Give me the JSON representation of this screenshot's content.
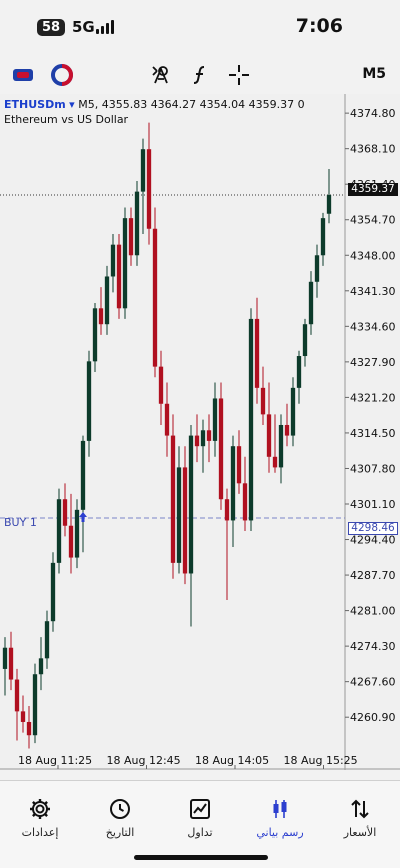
{
  "status_bar": {
    "badge": "58",
    "network": "5G",
    "time": "7:06"
  },
  "toolbar": {
    "icons": [
      "logo-red-blue-icon",
      "logo-blue-circle-icon",
      "indicator-icon",
      "function-icon",
      "crosshair-icon"
    ],
    "timeframe": "M5"
  },
  "chart": {
    "symbol": "ETHUSDm",
    "timeframe": "M5",
    "ohlc": "4355.83 4364.27 4354.04 4359.37 0",
    "subtitle": "Ethereum vs US Dollar",
    "current_price": "4359.37",
    "buy_label": "BUY 1",
    "buy_price": "4298.46",
    "x_labels": [
      "18 Aug 11:25",
      "18 Aug 12:45",
      "18 Aug 14:05",
      "18 Aug 15:25"
    ]
  },
  "chart_data": {
    "type": "candlestick",
    "price_ticks": [
      "4374.80",
      "4368.10",
      "4361.40",
      "4354.70",
      "4348.00",
      "4341.30",
      "4334.60",
      "4327.90",
      "4321.20",
      "4314.50",
      "4307.80",
      "4301.10",
      "4294.40",
      "4287.70",
      "4281.00",
      "4274.30",
      "4267.60",
      "4260.90"
    ],
    "ylim": [
      4256.6,
      4376.9
    ],
    "color_up": "#0d3b2b",
    "color_down": "#b01020",
    "candles": [
      {
        "o": 4270.0,
        "h": 4276.0,
        "l": 4265.0,
        "c": 4274.0
      },
      {
        "o": 4274.0,
        "h": 4277.0,
        "l": 4266.0,
        "c": 4268.0
      },
      {
        "o": 4268.0,
        "h": 4270.0,
        "l": 4256.5,
        "c": 4262.0
      },
      {
        "o": 4262.0,
        "h": 4265.0,
        "l": 4258.0,
        "c": 4260.0
      },
      {
        "o": 4260.0,
        "h": 4263.0,
        "l": 4255.0,
        "c": 4257.5
      },
      {
        "o": 4257.5,
        "h": 4271.0,
        "l": 4256.0,
        "c": 4269.0
      },
      {
        "o": 4269.0,
        "h": 4276.0,
        "l": 4266.0,
        "c": 4272.0
      },
      {
        "o": 4272.0,
        "h": 4281.0,
        "l": 4270.0,
        "c": 4279.0
      },
      {
        "o": 4279.0,
        "h": 4292.0,
        "l": 4277.0,
        "c": 4290.0
      },
      {
        "o": 4290.0,
        "h": 4304.0,
        "l": 4288.0,
        "c": 4302.0
      },
      {
        "o": 4302.0,
        "h": 4305.0,
        "l": 4295.0,
        "c": 4297.0
      },
      {
        "o": 4297.0,
        "h": 4303.0,
        "l": 4288.0,
        "c": 4291.0
      },
      {
        "o": 4291.0,
        "h": 4302.0,
        "l": 4289.0,
        "c": 4300.0
      },
      {
        "o": 4300.0,
        "h": 4314.0,
        "l": 4292.0,
        "c": 4313.0
      },
      {
        "o": 4313.0,
        "h": 4330.0,
        "l": 4310.0,
        "c": 4328.0
      },
      {
        "o": 4328.0,
        "h": 4339.0,
        "l": 4326.0,
        "c": 4338.0
      },
      {
        "o": 4338.0,
        "h": 4342.0,
        "l": 4333.0,
        "c": 4335.0
      },
      {
        "o": 4335.0,
        "h": 4346.0,
        "l": 4333.0,
        "c": 4344.0
      },
      {
        "o": 4344.0,
        "h": 4352.0,
        "l": 4341.0,
        "c": 4350.0
      },
      {
        "o": 4350.0,
        "h": 4352.0,
        "l": 4336.0,
        "c": 4338.0
      },
      {
        "o": 4338.0,
        "h": 4357.0,
        "l": 4336.0,
        "c": 4355.0
      },
      {
        "o": 4355.0,
        "h": 4357.0,
        "l": 4346.0,
        "c": 4348.0
      },
      {
        "o": 4348.0,
        "h": 4362.0,
        "l": 4346.0,
        "c": 4360.0
      },
      {
        "o": 4360.0,
        "h": 4370.0,
        "l": 4352.0,
        "c": 4368.0
      },
      {
        "o": 4368.0,
        "h": 4373.0,
        "l": 4350.0,
        "c": 4353.0
      },
      {
        "o": 4353.0,
        "h": 4357.0,
        "l": 4325.0,
        "c": 4327.0
      },
      {
        "o": 4327.0,
        "h": 4330.0,
        "l": 4316.0,
        "c": 4320.0
      },
      {
        "o": 4320.0,
        "h": 4324.0,
        "l": 4310.0,
        "c": 4314.0
      },
      {
        "o": 4314.0,
        "h": 4318.0,
        "l": 4287.0,
        "c": 4290.0
      },
      {
        "o": 4290.0,
        "h": 4312.0,
        "l": 4288.0,
        "c": 4308.0
      },
      {
        "o": 4308.0,
        "h": 4312.0,
        "l": 4286.0,
        "c": 4288.0
      },
      {
        "o": 4288.0,
        "h": 4316.0,
        "l": 4278.0,
        "c": 4314.0
      },
      {
        "o": 4314.0,
        "h": 4318.0,
        "l": 4309.0,
        "c": 4312.0
      },
      {
        "o": 4312.0,
        "h": 4317.0,
        "l": 4307.0,
        "c": 4315.0
      },
      {
        "o": 4315.0,
        "h": 4318.0,
        "l": 4309.0,
        "c": 4313.0
      },
      {
        "o": 4313.0,
        "h": 4324.0,
        "l": 4310.0,
        "c": 4321.0
      },
      {
        "o": 4321.0,
        "h": 4324.0,
        "l": 4300.0,
        "c": 4302.0
      },
      {
        "o": 4302.0,
        "h": 4304.0,
        "l": 4283.0,
        "c": 4298.0
      },
      {
        "o": 4298.0,
        "h": 4314.0,
        "l": 4293.0,
        "c": 4312.0
      },
      {
        "o": 4312.0,
        "h": 4315.0,
        "l": 4303.0,
        "c": 4305.0
      },
      {
        "o": 4305.0,
        "h": 4310.0,
        "l": 4296.0,
        "c": 4298.0
      },
      {
        "o": 4298.0,
        "h": 4338.0,
        "l": 4296.0,
        "c": 4336.0
      },
      {
        "o": 4336.0,
        "h": 4340.0,
        "l": 4320.0,
        "c": 4323.0
      },
      {
        "o": 4323.0,
        "h": 4327.0,
        "l": 4316.0,
        "c": 4318.0
      },
      {
        "o": 4318.0,
        "h": 4324.0,
        "l": 4307.0,
        "c": 4310.0
      },
      {
        "o": 4310.0,
        "h": 4318.0,
        "l": 4307.0,
        "c": 4308.0
      },
      {
        "o": 4308.0,
        "h": 4318.0,
        "l": 4305.0,
        "c": 4316.0
      },
      {
        "o": 4316.0,
        "h": 4320.0,
        "l": 4312.0,
        "c": 4314.0
      },
      {
        "o": 4314.0,
        "h": 4325.0,
        "l": 4312.0,
        "c": 4323.0
      },
      {
        "o": 4323.0,
        "h": 4330.0,
        "l": 4320.0,
        "c": 4329.0
      },
      {
        "o": 4329.0,
        "h": 4336.0,
        "l": 4327.0,
        "c": 4335.0
      },
      {
        "o": 4335.0,
        "h": 4345.0,
        "l": 4333.0,
        "c": 4343.0
      },
      {
        "o": 4343.0,
        "h": 4350.0,
        "l": 4340.0,
        "c": 4348.0
      },
      {
        "o": 4348.0,
        "h": 4356.0,
        "l": 4346.0,
        "c": 4355.0
      },
      {
        "o": 4355.83,
        "h": 4364.27,
        "l": 4354.04,
        "c": 4359.37
      }
    ]
  },
  "bottom_nav": {
    "items": [
      {
        "label": "إعدادات",
        "icon": "gear-icon"
      },
      {
        "label": "التاريخ",
        "icon": "history-icon"
      },
      {
        "label": "تداول",
        "icon": "trade-chart-icon"
      },
      {
        "label": "رسم بياني",
        "icon": "candlestick-icon",
        "active": true
      },
      {
        "label": "الأسعار",
        "icon": "quotes-arrows-icon"
      }
    ],
    "active_color": "#2c3fcf"
  }
}
